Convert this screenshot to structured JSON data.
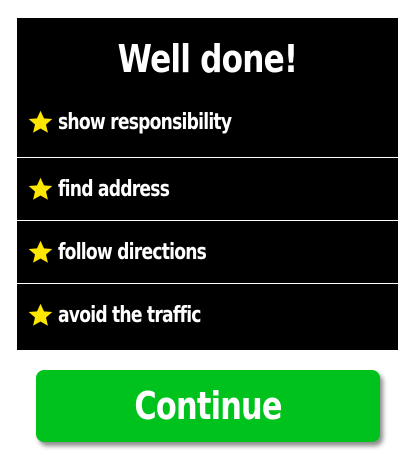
{
  "panel": {
    "title": "Well done!",
    "items": [
      {
        "label": "show responsibility",
        "icon": "star-icon"
      },
      {
        "label": "find address",
        "icon": "star-icon"
      },
      {
        "label": "follow directions",
        "icon": "star-icon"
      },
      {
        "label": "avoid the traffic",
        "icon": "star-icon"
      }
    ]
  },
  "continue_button": {
    "label": "Continue"
  },
  "colors": {
    "panel_bg": "#000000",
    "star": "#ffe600",
    "button": "#00c21c",
    "text": "#ffffff"
  }
}
